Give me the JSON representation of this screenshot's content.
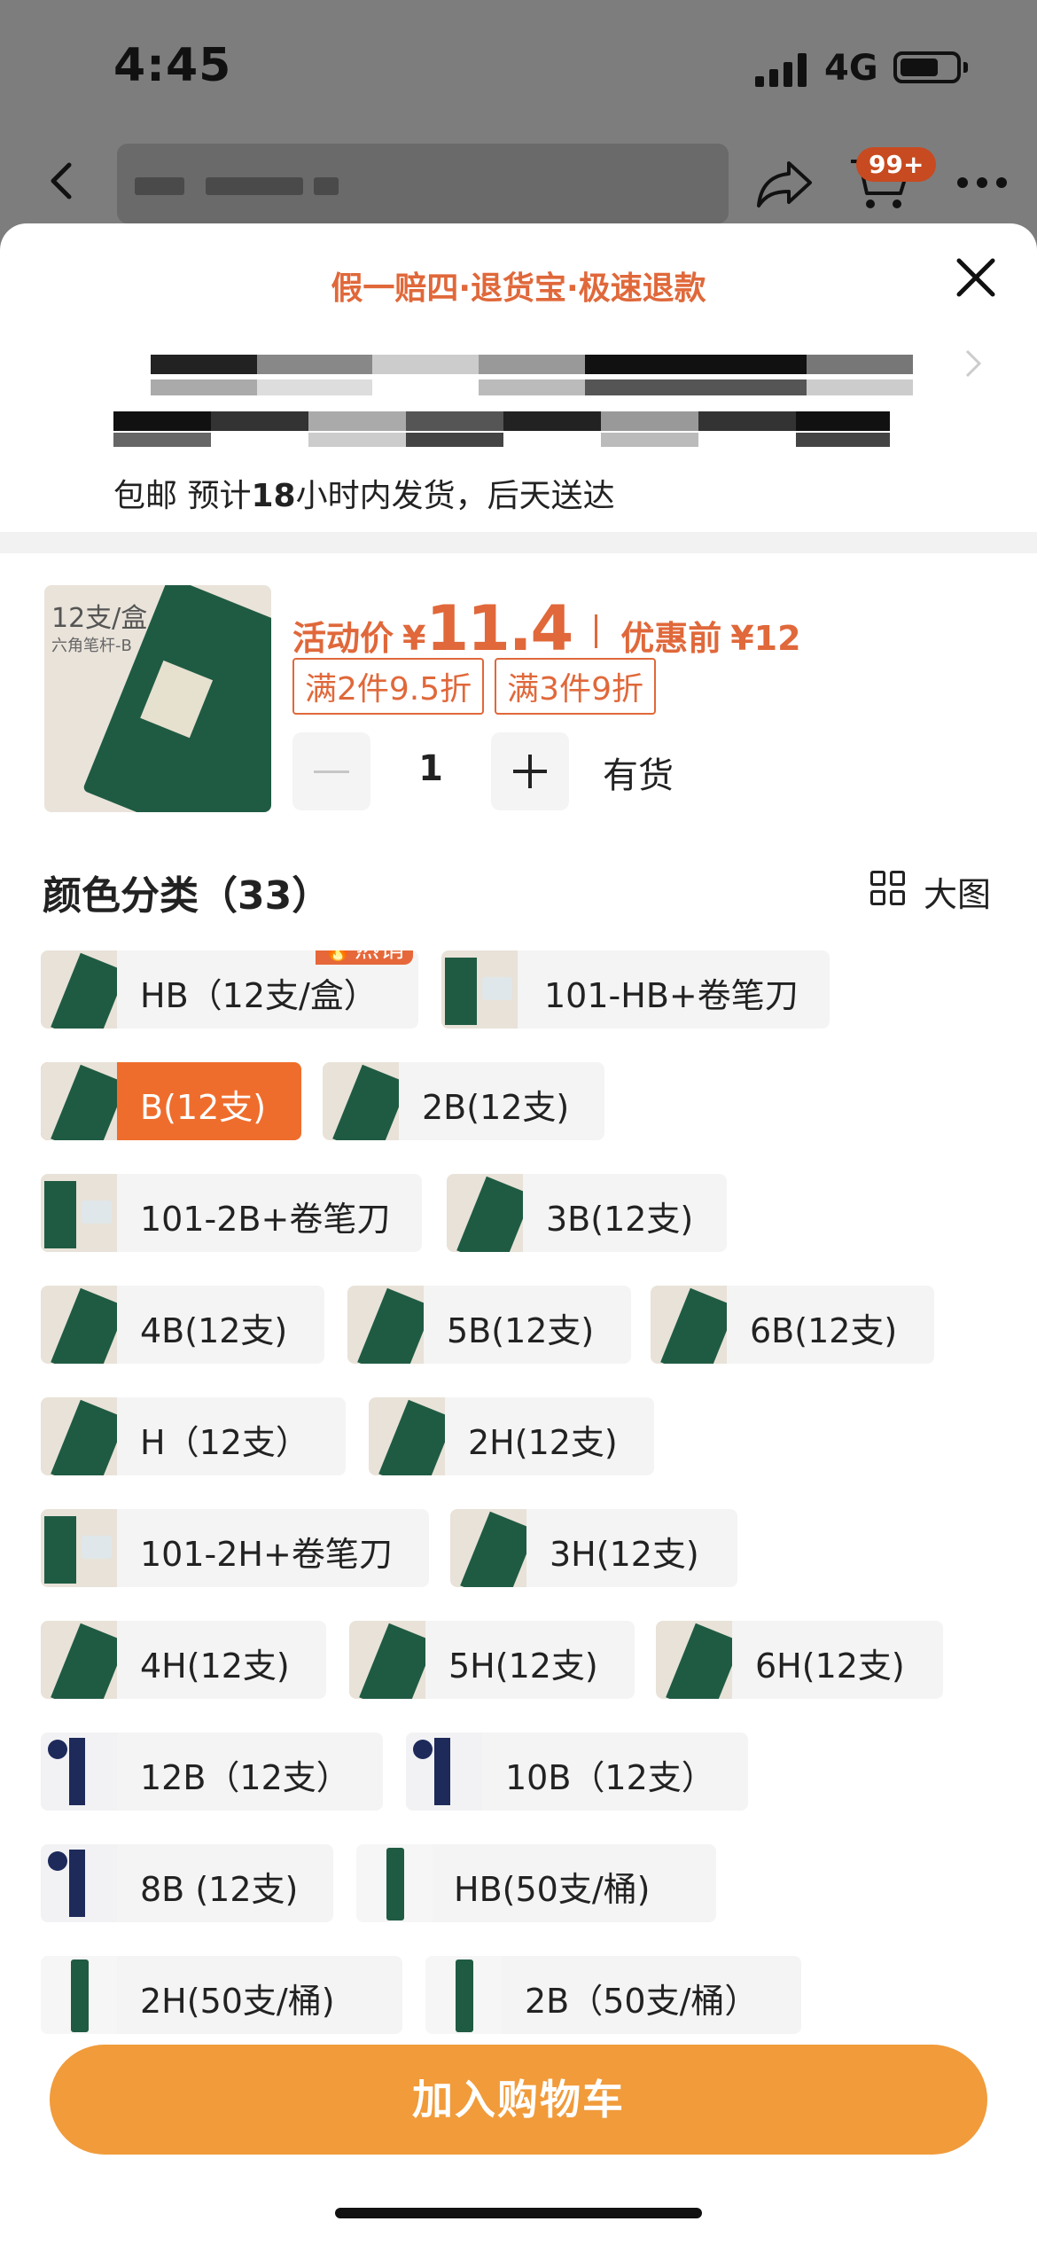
{
  "status_bar": {
    "time": "4:45",
    "network": "4G"
  },
  "nav": {
    "cart_badge": "99+"
  },
  "sheet": {
    "promo": "假一赔四·退货宝·极速退款",
    "shipping": {
      "pre": "包邮 预计",
      "hours": "18",
      "post": "小时内发货，后天送达"
    }
  },
  "product": {
    "thumb_tag": "12支/盒",
    "thumb_sub": "六角笔杆-B",
    "price_label": "活动价",
    "currency": "¥",
    "price": "11.4",
    "orig_label": "优惠前",
    "orig_price": "12",
    "coupons": [
      "满2件9.5折",
      "满3件9折"
    ],
    "quantity": "1",
    "stock": "有货"
  },
  "variants_section": {
    "title": "颜色分类（33）",
    "big_view": "大图",
    "hot_label": "热销"
  },
  "variants": [
    {
      "label": "HB（12支/盒）",
      "img": "box",
      "hot": true
    },
    {
      "label": "101-HB+卷笔刀",
      "img": "kit"
    },
    {
      "label": "B(12支)",
      "img": "box",
      "selected": true
    },
    {
      "label": "2B(12支)",
      "img": "box"
    },
    {
      "label": "101-2B+卷笔刀",
      "img": "kit"
    },
    {
      "label": "3B(12支)",
      "img": "box"
    },
    {
      "label": "4B(12支)",
      "img": "box"
    },
    {
      "label": "5B(12支)",
      "img": "box"
    },
    {
      "label": "6B(12支)",
      "img": "box"
    },
    {
      "label": "H（12支）",
      "img": "box"
    },
    {
      "label": "2H(12支)",
      "img": "box"
    },
    {
      "label": "101-2H+卷笔刀",
      "img": "kit"
    },
    {
      "label": "3H(12支)",
      "img": "box"
    },
    {
      "label": "4H(12支)",
      "img": "box"
    },
    {
      "label": "5H(12支)",
      "img": "box"
    },
    {
      "label": "6H(12支)",
      "img": "box"
    },
    {
      "label": "12B（12支）",
      "img": "blue"
    },
    {
      "label": "10B（12支）",
      "img": "blue"
    },
    {
      "label": "8B (12支)",
      "img": "blue"
    },
    {
      "label": "HB(50支/桶)",
      "img": "tube"
    },
    {
      "label": "2H(50支/桶)",
      "img": "tube"
    },
    {
      "label": "2B（50支/桶）",
      "img": "tube"
    }
  ],
  "add_to_cart": "加入购物车",
  "colors": {
    "accent": "#e0683a",
    "selected_chip": "#ef6d2c",
    "cta": "#f19b3a",
    "pencil_green": "#1f5b43"
  }
}
